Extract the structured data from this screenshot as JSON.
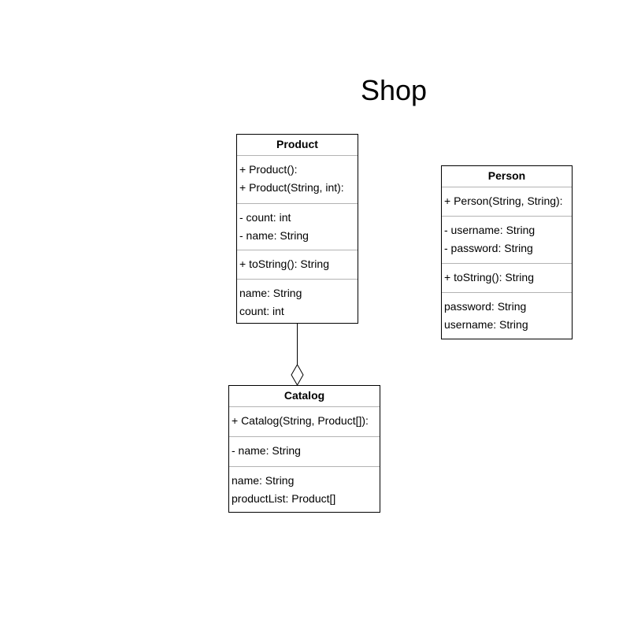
{
  "diagram": {
    "title": "Shop"
  },
  "classes": {
    "product": {
      "name": "Product",
      "constructors": [
        "+ Product():",
        "+ Product(String, int):"
      ],
      "fields": [
        "- count: int",
        "- name: String"
      ],
      "methods": [
        "+ toString(): String"
      ],
      "properties": [
        "name: String",
        "count: int"
      ]
    },
    "person": {
      "name": "Person",
      "constructors": [
        "+ Person(String, String):"
      ],
      "fields": [
        "- username: String",
        "- password: String"
      ],
      "methods": [
        "+ toString(): String"
      ],
      "properties": [
        "password: String",
        "username: String"
      ]
    },
    "catalog": {
      "name": "Catalog",
      "constructors": [
        "+ Catalog(String, Product[]):"
      ],
      "fields": [
        "- name: String"
      ],
      "properties": [
        "name: String",
        "productList: Product[]"
      ]
    }
  },
  "relations": [
    {
      "from": "product",
      "to": "catalog",
      "kind": "aggregation"
    }
  ],
  "colors": {
    "border": "#000000",
    "divider": "#b3b3b3",
    "background": "#ffffff"
  }
}
